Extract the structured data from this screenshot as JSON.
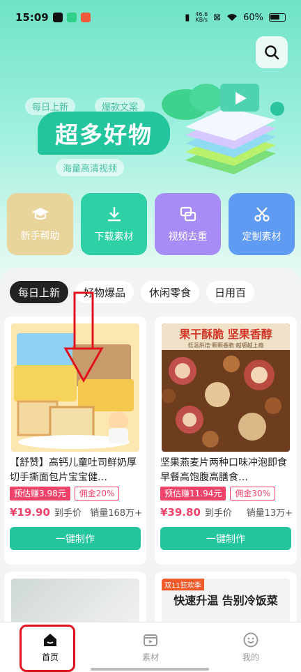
{
  "status": {
    "time": "15:09",
    "net_speed": "46.6",
    "net_unit": "KB/s",
    "battery": "60%"
  },
  "banner": {
    "pill1": "每日上新",
    "pill2": "爆款文案",
    "title": "超多好物",
    "pill3": "海量高清视频"
  },
  "quick_actions": [
    {
      "label": "新手帮助",
      "icon": "graduation-cap-icon",
      "color": "#ead7a0"
    },
    {
      "label": "下载素材",
      "icon": "download-icon",
      "color": "#2ed0a6"
    },
    {
      "label": "视频去重",
      "icon": "duplicate-icon",
      "color": "#a88cf5"
    },
    {
      "label": "定制素材",
      "icon": "scissors-icon",
      "color": "#5f9bf2"
    }
  ],
  "tabs": [
    "每日上新",
    "好物爆品",
    "休闲零食",
    "日用百"
  ],
  "products": [
    {
      "title": "【舒赞】高钙儿童吐司鲜奶厚切手撕面包片宝宝健…",
      "estimate": "预估赚3.98元",
      "commission": "佣金20%",
      "price": "¥19.90",
      "hand_price": "到手价",
      "sales": "销量168万+",
      "button": "一键制作"
    },
    {
      "title": "坚果燕麦片两种口味冲泡即食早餐高饱腹高膳食…",
      "estimate": "预估赚11.94元",
      "commission": "佣金30%",
      "price": "¥39.80",
      "hand_price": "到手价",
      "sales": "销量13万+",
      "button": "一键制作",
      "thumb_banner": "果干酥脆 坚果香醇",
      "thumb_sub": "低温烘焙·颗颗香脆·越嚼越上瘾"
    }
  ],
  "second_row": {
    "right_tag": "双11狂欢季",
    "right_title": "快速升温 告别冷饭菜"
  },
  "nav": [
    {
      "label": "首页",
      "icon": "home-icon"
    },
    {
      "label": "素材",
      "icon": "material-icon"
    },
    {
      "label": "我的",
      "icon": "smile-icon"
    }
  ]
}
